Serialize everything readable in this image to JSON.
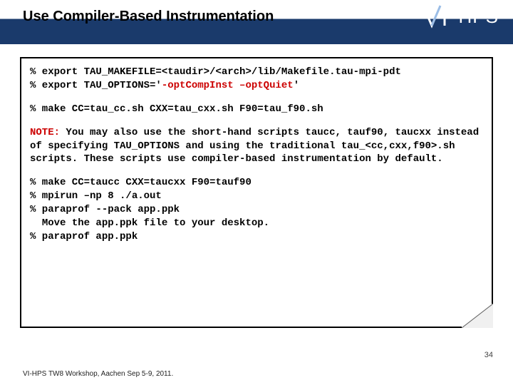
{
  "header": {
    "title": "Use Compiler-Based Instrumentation",
    "logo_prefix": "VI",
    "logo_suffix": "HPS"
  },
  "code": {
    "l1a": "% export TAU_MAKEFILE=<taudir>/<arch>/lib/Makefile.tau-mpi-pdt",
    "l2a": "% export TAU_OPTIONS='",
    "l2b": "-optCompInst –optQuiet",
    "l2c": "'",
    "l3": "% make CC=tau_cc.sh CXX=tau_cxx.sh F90=tau_f90.sh",
    "note_label": "NOTE:",
    "note_body": " You may also use the short-hand scripts taucc, tauf90, taucxx instead of specifying TAU_OPTIONS and using the traditional tau_<cc,cxx,f90>.sh scripts. These scripts use compiler-based instrumentation by default.",
    "l4": "% make CC=taucc CXX=taucxx F90=tauf90",
    "l5": "% mpirun –np 8 ./a.out",
    "l6": "% paraprof --pack app.ppk",
    "l7": "  Move the app.ppk file to your desktop.",
    "l8": "% paraprof app.ppk"
  },
  "footer": "VI-HPS TW8 Workshop, Aachen Sep 5-9, 2011.",
  "page": "34"
}
